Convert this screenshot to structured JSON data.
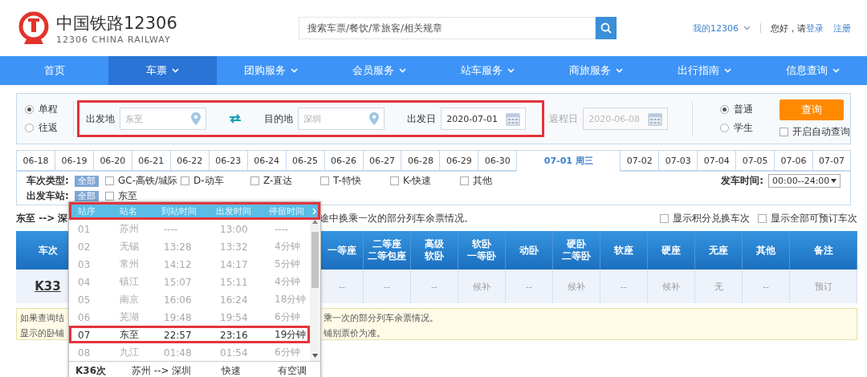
{
  "header": {
    "logo_title": "中国铁路12306",
    "logo_subtitle": "12306 CHINA RAILWAY",
    "search_placeholder": "搜索车票/餐饮/常旅客/相关规章",
    "account": "我的12306",
    "greeting": "您好，请",
    "login": "登录",
    "register": "注册"
  },
  "nav": [
    {
      "label": "首页",
      "dropdown": false,
      "selected": false
    },
    {
      "label": "车票",
      "dropdown": true,
      "selected": true
    },
    {
      "label": "团购服务",
      "dropdown": true,
      "selected": false
    },
    {
      "label": "会员服务",
      "dropdown": true,
      "selected": false
    },
    {
      "label": "站车服务",
      "dropdown": true,
      "selected": false
    },
    {
      "label": "商旅服务",
      "dropdown": true,
      "selected": false
    },
    {
      "label": "出行指南",
      "dropdown": true,
      "selected": false
    },
    {
      "label": "信息查询",
      "dropdown": true,
      "selected": false
    }
  ],
  "search": {
    "trip_types": [
      {
        "label": "单程",
        "selected": true
      },
      {
        "label": "往返",
        "selected": false
      }
    ],
    "from": {
      "label": "出发地",
      "value": "东至"
    },
    "to": {
      "label": "目的地",
      "value": "深圳"
    },
    "depart": {
      "label": "出发日",
      "value": "2020-07-01"
    },
    "return": {
      "label": "返程日",
      "value": "2020-06-08",
      "disabled": true
    },
    "passenger_types": [
      {
        "label": "普通",
        "selected": true
      },
      {
        "label": "学生",
        "selected": false
      }
    ],
    "query_button": "查询",
    "auto_query": {
      "label": "开启自动查询",
      "checked": false
    }
  },
  "dates": [
    {
      "label": "06-18",
      "selected": false
    },
    {
      "label": "06-19",
      "selected": false
    },
    {
      "label": "06-20",
      "selected": false
    },
    {
      "label": "06-21",
      "selected": false
    },
    {
      "label": "06-22",
      "selected": false
    },
    {
      "label": "06-23",
      "selected": false
    },
    {
      "label": "06-24",
      "selected": false
    },
    {
      "label": "06-25",
      "selected": false
    },
    {
      "label": "06-26",
      "selected": false
    },
    {
      "label": "06-27",
      "selected": false
    },
    {
      "label": "06-28",
      "selected": false
    },
    {
      "label": "06-29",
      "selected": false
    },
    {
      "label": "06-30",
      "selected": false
    },
    {
      "label": "07-01 周三",
      "selected": true
    },
    {
      "label": "07-02",
      "selected": false
    },
    {
      "label": "07-03",
      "selected": false
    },
    {
      "label": "07-04",
      "selected": false
    },
    {
      "label": "07-05",
      "selected": false
    },
    {
      "label": "07-06",
      "selected": false
    },
    {
      "label": "07-07",
      "selected": false
    }
  ],
  "filters": {
    "train_type_label": "车次类型:",
    "all_label": "全部",
    "all_selected": true,
    "train_types": [
      {
        "label": "GC-高铁/城际",
        "checked": false
      },
      {
        "label": "D-动车",
        "checked": false
      },
      {
        "label": "Z-直达",
        "checked": false
      },
      {
        "label": "T-特快",
        "checked": false
      },
      {
        "label": "K-快速",
        "checked": false
      },
      {
        "label": "其他",
        "checked": false
      }
    ],
    "time_label": "发车时间:",
    "time_value": "00:00--24:00",
    "station_label": "出发车站:",
    "station_all_label": "全部",
    "station_all_selected": true,
    "stations": [
      {
        "label": "东至",
        "checked": false
      }
    ]
  },
  "route": {
    "title": "东至 --> 深",
    "note": "途中换乘一次的部分列车余票情况。",
    "options": [
      {
        "label": "显示积分兑换车次",
        "checked": false
      },
      {
        "label": "显示全部可预订车次",
        "checked": false
      }
    ]
  },
  "table": {
    "train_column": "车次",
    "columns": [
      {
        "lines": [
          "一等座"
        ]
      },
      {
        "lines": [
          "二等座",
          "二等包座"
        ]
      },
      {
        "lines": [
          "高级",
          "软卧"
        ]
      },
      {
        "lines": [
          "软卧",
          "一等卧"
        ]
      },
      {
        "lines": [
          "动卧"
        ]
      },
      {
        "lines": [
          "硬卧",
          "二等卧"
        ]
      },
      {
        "lines": [
          "软座"
        ]
      },
      {
        "lines": [
          "硬座"
        ]
      },
      {
        "lines": [
          "无座"
        ]
      },
      {
        "lines": [
          "其他"
        ]
      },
      {
        "lines": [
          "备注"
        ]
      }
    ],
    "rows": [
      {
        "train": "K33",
        "cells": [
          "--",
          "--",
          "--",
          "候补",
          "--",
          "候补",
          "--",
          "候补",
          "无",
          "--"
        ],
        "action": "预订"
      }
    ]
  },
  "notice": {
    "left": [
      "如果查询结",
      "显示的卧铺"
    ],
    "right": [
      "乘一次的部分列车余票情况。",
      "铺别票价为准。"
    ]
  },
  "stops_popup": {
    "columns": [
      "站序",
      "站名",
      "到站时间",
      "出发时间",
      "停留时间"
    ],
    "rows": [
      {
        "seq": "01",
        "station": "苏州",
        "arrive": "----",
        "depart": "13:00",
        "stay": "----",
        "selected": false
      },
      {
        "seq": "02",
        "station": "无锡",
        "arrive": "13:28",
        "depart": "13:32",
        "stay": "4分钟",
        "selected": false
      },
      {
        "seq": "03",
        "station": "常州",
        "arrive": "14:12",
        "depart": "14:17",
        "stay": "5分钟",
        "selected": false
      },
      {
        "seq": "04",
        "station": "镇江",
        "arrive": "15:07",
        "depart": "15:11",
        "stay": "4分钟",
        "selected": false
      },
      {
        "seq": "05",
        "station": "南京",
        "arrive": "16:06",
        "depart": "16:24",
        "stay": "18分钟",
        "selected": false
      },
      {
        "seq": "06",
        "station": "芜湖",
        "arrive": "19:48",
        "depart": "19:54",
        "stay": "6分钟",
        "selected": false
      },
      {
        "seq": "07",
        "station": "东至",
        "arrive": "22:57",
        "depart": "23:16",
        "stay": "19分钟",
        "selected": true
      },
      {
        "seq": "08",
        "station": "九江",
        "arrive": "01:48",
        "depart": "01:54",
        "stay": "6分钟",
        "selected": false
      }
    ],
    "footer": {
      "train": "K36次",
      "route": "苏州 --> 深圳",
      "type": "快速",
      "facility": "有空调"
    }
  }
}
